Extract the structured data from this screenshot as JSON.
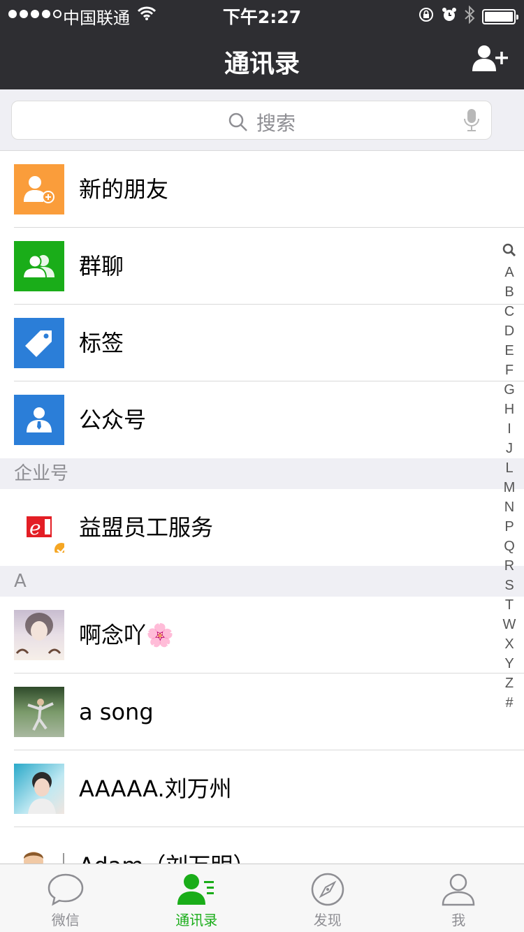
{
  "status_bar": {
    "carrier": "中国联通",
    "time": "下午2:27"
  },
  "nav": {
    "title": "通讯录"
  },
  "search": {
    "placeholder": "搜索"
  },
  "functions": [
    {
      "label": "新的朋友",
      "icon": "new-friend-icon",
      "color": "#fa9d3b"
    },
    {
      "label": "群聊",
      "icon": "group-chat-icon",
      "color": "#1aad19"
    },
    {
      "label": "标签",
      "icon": "tag-icon",
      "color": "#2b7ed8"
    },
    {
      "label": "公众号",
      "icon": "official-account-icon",
      "color": "#2b7ed8"
    }
  ],
  "enterprise_section": {
    "header": "企业号",
    "items": [
      {
        "name": "益盟员工服务"
      }
    ]
  },
  "contact_section": {
    "header": "A",
    "contacts": [
      {
        "name": "啊念吖🌸"
      },
      {
        "name": "a song"
      },
      {
        "name": "AAAAA.刘万州"
      },
      {
        "name": "Adam（刘万明）"
      }
    ]
  },
  "index_letters": [
    "A",
    "B",
    "C",
    "D",
    "E",
    "F",
    "G",
    "H",
    "I",
    "J",
    "L",
    "M",
    "N",
    "P",
    "Q",
    "R",
    "S",
    "T",
    "W",
    "X",
    "Y",
    "Z",
    "#"
  ],
  "tabs": [
    {
      "label": "微信",
      "icon": "chat-bubble-icon"
    },
    {
      "label": "通讯录",
      "icon": "contacts-icon",
      "active": true
    },
    {
      "label": "发现",
      "icon": "compass-icon"
    },
    {
      "label": "我",
      "icon": "profile-icon"
    }
  ],
  "colors": {
    "accent": "#1aad19",
    "navbar": "#2e2e32",
    "background": "#efeff4"
  }
}
